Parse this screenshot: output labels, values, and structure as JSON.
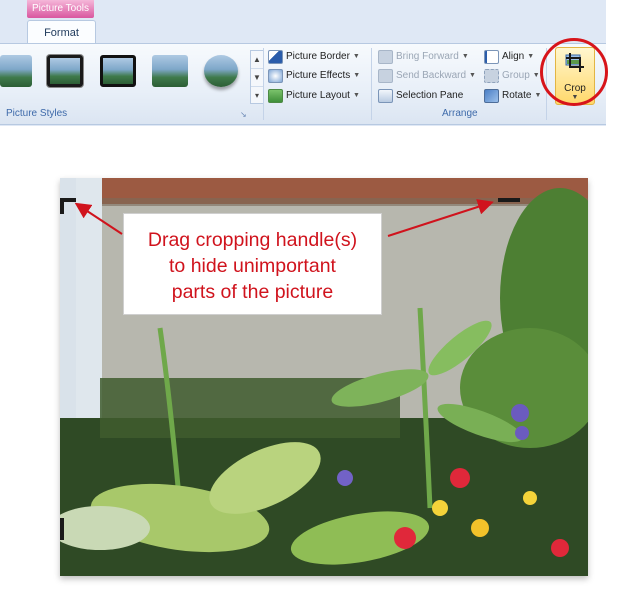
{
  "ribbon": {
    "contextual_tab": "Picture Tools",
    "active_tab": "Format",
    "picture_styles_group_label": "Picture Styles",
    "picture_commands": [
      {
        "label": "Picture Border",
        "icon": "pencil-border-icon",
        "enabled": true
      },
      {
        "label": "Picture Effects",
        "icon": "effects-icon",
        "enabled": true
      },
      {
        "label": "Picture Layout",
        "icon": "layout-icon",
        "enabled": true
      }
    ],
    "arrange": {
      "group_label": "Arrange",
      "bring_forward": "Bring Forward",
      "send_backward": "Send Backward",
      "selection_pane": "Selection Pane",
      "align": "Align",
      "group": "Group",
      "rotate": "Rotate"
    },
    "crop_label": "Crop",
    "highlight_color": "#d7141a"
  },
  "callout": {
    "line1": "Drag cropping handle(s)",
    "line2": "to hide unimportant",
    "line3": "parts of the picture",
    "text_color": "#d0131d"
  }
}
